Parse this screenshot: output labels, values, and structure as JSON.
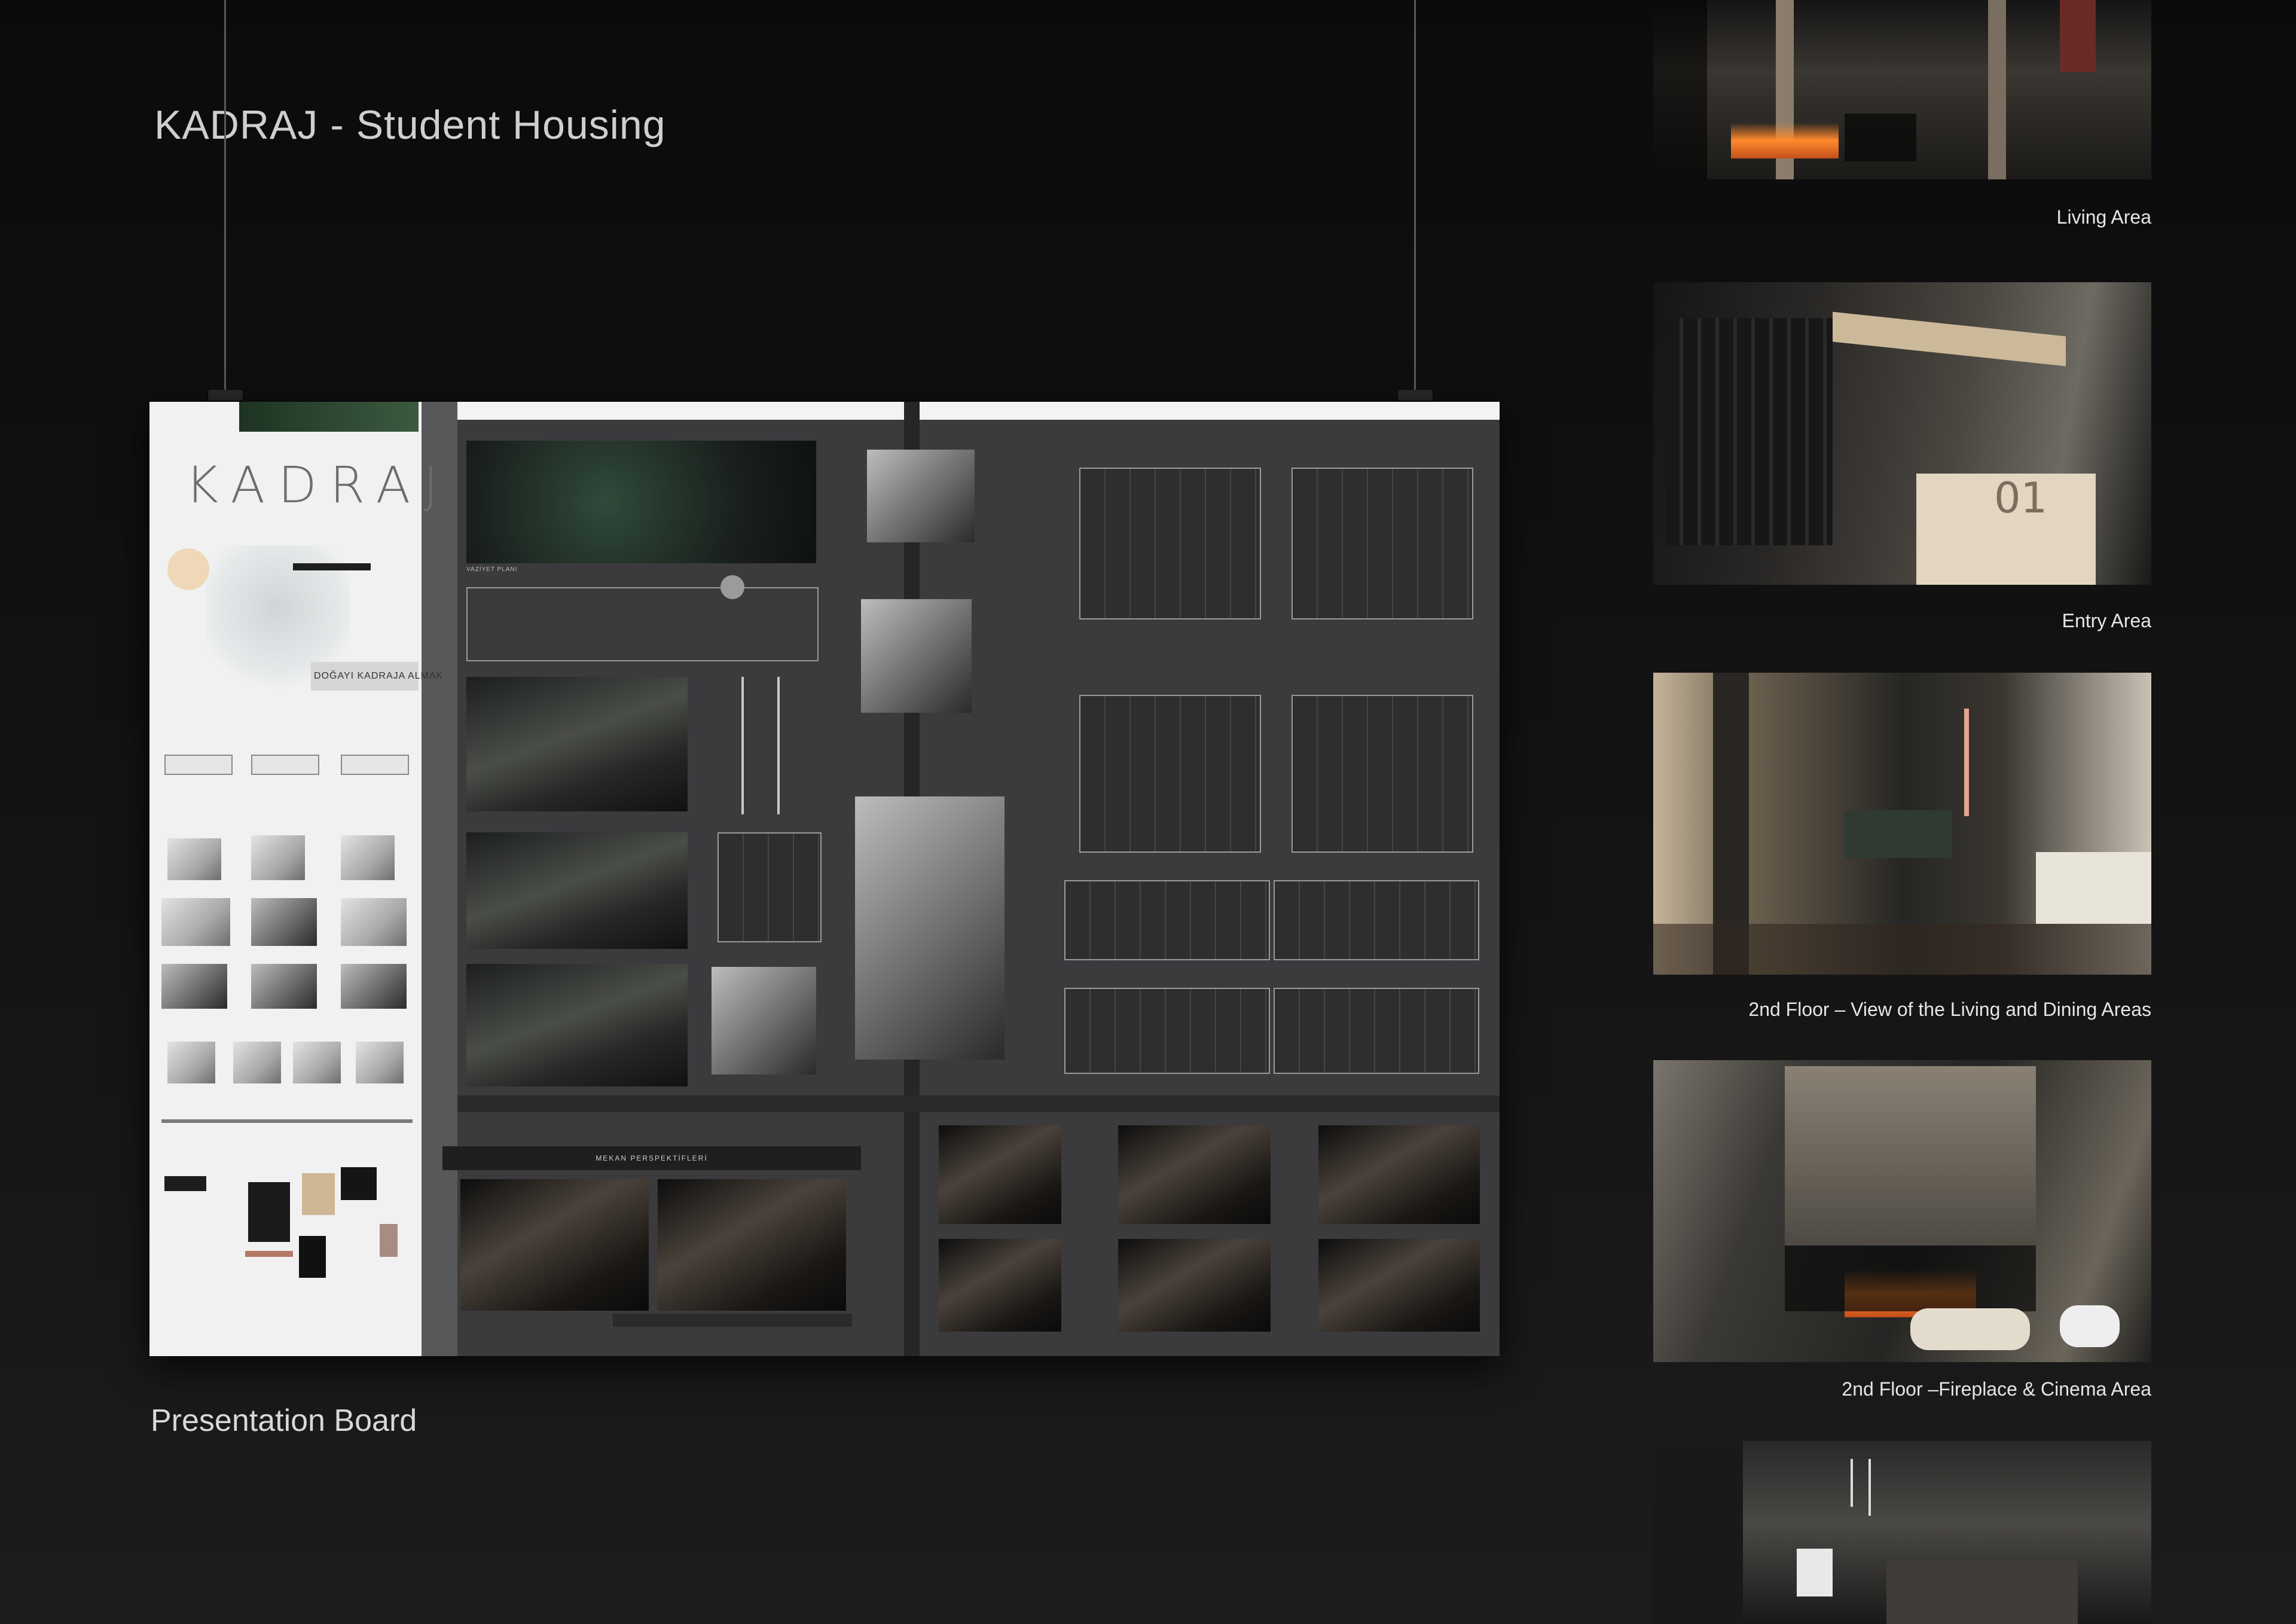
{
  "header": {
    "title": "KADRAJ - Student Housing"
  },
  "poster": {
    "logo": "KADRAJ",
    "motto": "DOĞAYI KADRAJA ALMAK",
    "section_label": "MEKAN PERSPEKTİFLERİ"
  },
  "captions": {
    "presentation_board": "Presentation Board",
    "living_area": "Living Area",
    "entry_area": "Entry Area",
    "second_floor_living_dining": "2nd Floor – View of the Living and Dining Areas",
    "second_floor_fireplace": "2nd Floor –Fireplace & Cinema Area"
  },
  "colors": {
    "background": "#0f0f10",
    "poster_dark": "#3b3a3d",
    "poster_light": "#f1f1f1",
    "caption_text": "#e6e6e6"
  }
}
